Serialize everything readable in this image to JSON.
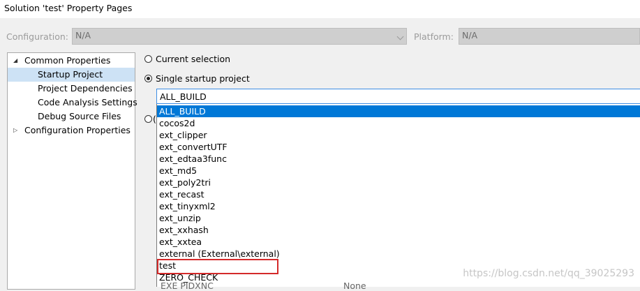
{
  "window": {
    "title": "Solution 'test' Property Pages"
  },
  "config_row": {
    "configuration_label": "Configuration:",
    "configuration_value": "N/A",
    "platform_label": "Platform:",
    "platform_value": "N/A"
  },
  "tree": {
    "items": [
      {
        "label": "Common Properties",
        "toggle": "◢",
        "expanded": true
      },
      {
        "label": "Startup Project",
        "selected": true
      },
      {
        "label": "Project Dependencies"
      },
      {
        "label": "Code Analysis Settings"
      },
      {
        "label": "Debug Source Files"
      },
      {
        "label": "Configuration Properties",
        "toggle": "▷",
        "expanded": false
      }
    ]
  },
  "startup": {
    "current_selection_label": "Current selection",
    "single_startup_label": "Single startup project",
    "multiple_startup_partial": "(",
    "selected_value": "ALL_BUILD"
  },
  "dropdown": {
    "options": [
      "ALL_BUILD",
      "cocos2d",
      "ext_clipper",
      "ext_convertUTF",
      "ext_edtaa3func",
      "ext_md5",
      "ext_poly2tri",
      "ext_recast",
      "ext_tinyxml2",
      "ext_unzip",
      "ext_xxhash",
      "ext_xxtea",
      "external (External\\external)",
      "test",
      "ZERO_CHECK"
    ],
    "selected_index": 0,
    "highlighted_option": "test"
  },
  "obscured": {
    "left_text": "EXE PIDXNC",
    "right_text": "None"
  },
  "watermark": "https://blog.csdn.net/qq_39025293",
  "colors": {
    "selection_blue": "#0078d7",
    "tree_selection": "#cde2f5",
    "highlight_red": "#d42a2a"
  }
}
